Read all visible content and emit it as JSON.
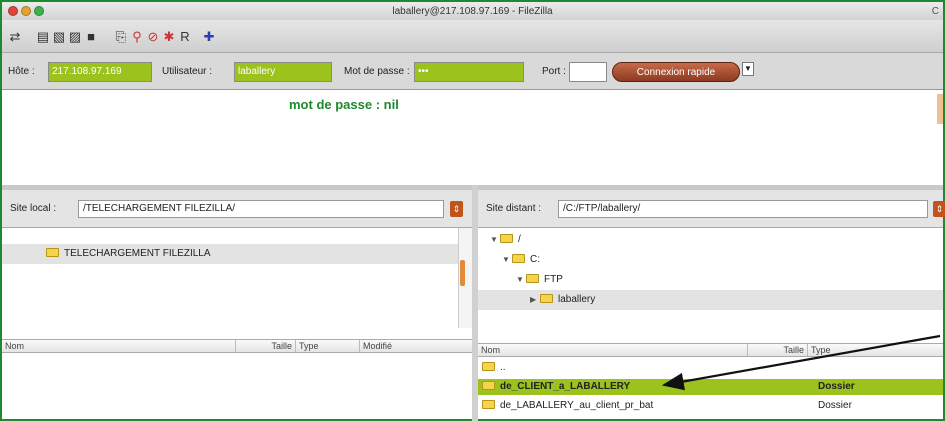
{
  "window": {
    "title": "laballery@217.108.97.169 - FileZilla",
    "title_right": "C"
  },
  "toolbar": {
    "icons": [
      "site-manager-icon",
      "toggle-log-icon",
      "toggle-local-tree-icon",
      "toggle-remote-tree-icon",
      "toggle-queue-icon",
      "refresh-icon",
      "filter-icon",
      "cancel-icon",
      "disconnect-icon",
      "reconnect-icon",
      "compare-icon"
    ]
  },
  "quickconnect": {
    "host_label": "Hôte :",
    "host_value": "217.108.97.169",
    "user_label": "Utilisateur :",
    "user_value": "laballery",
    "pass_label": "Mot de passe :",
    "pass_value": "•••",
    "port_label": "Port :",
    "port_value": "",
    "connect_label": "Connexion rapide"
  },
  "log": {
    "message": "mot de passe : nil"
  },
  "local": {
    "label": "Site local :",
    "path": "/TELECHARGEMENT FILEZILLA/",
    "tree": [
      {
        "label": "TELECHARGEMENT FILEZILLA",
        "selected": true
      }
    ],
    "columns": {
      "name": "Nom",
      "size": "Taille",
      "type": "Type",
      "modified": "Modifié"
    }
  },
  "remote": {
    "label": "Site distant :",
    "path": "/C:/FTP/laballery/",
    "tree": [
      {
        "label": "/",
        "indent": 0
      },
      {
        "label": "C:",
        "indent": 1
      },
      {
        "label": "FTP",
        "indent": 2
      },
      {
        "label": "laballery",
        "indent": 3,
        "selected": true
      }
    ],
    "columns": {
      "name": "Nom",
      "size": "Taille",
      "type": "Type"
    },
    "files": [
      {
        "name": "..",
        "type": ""
      },
      {
        "name": "de_CLIENT_a_LABALLERY",
        "type": "Dossier",
        "selected": true
      },
      {
        "name": "de_LABALLERY_au_client_pr_bat",
        "type": "Dossier"
      }
    ]
  },
  "colors": {
    "accent_green": "#9cc21e",
    "frame_green": "#1e8a2e",
    "connect_button": "#a04a2c"
  }
}
